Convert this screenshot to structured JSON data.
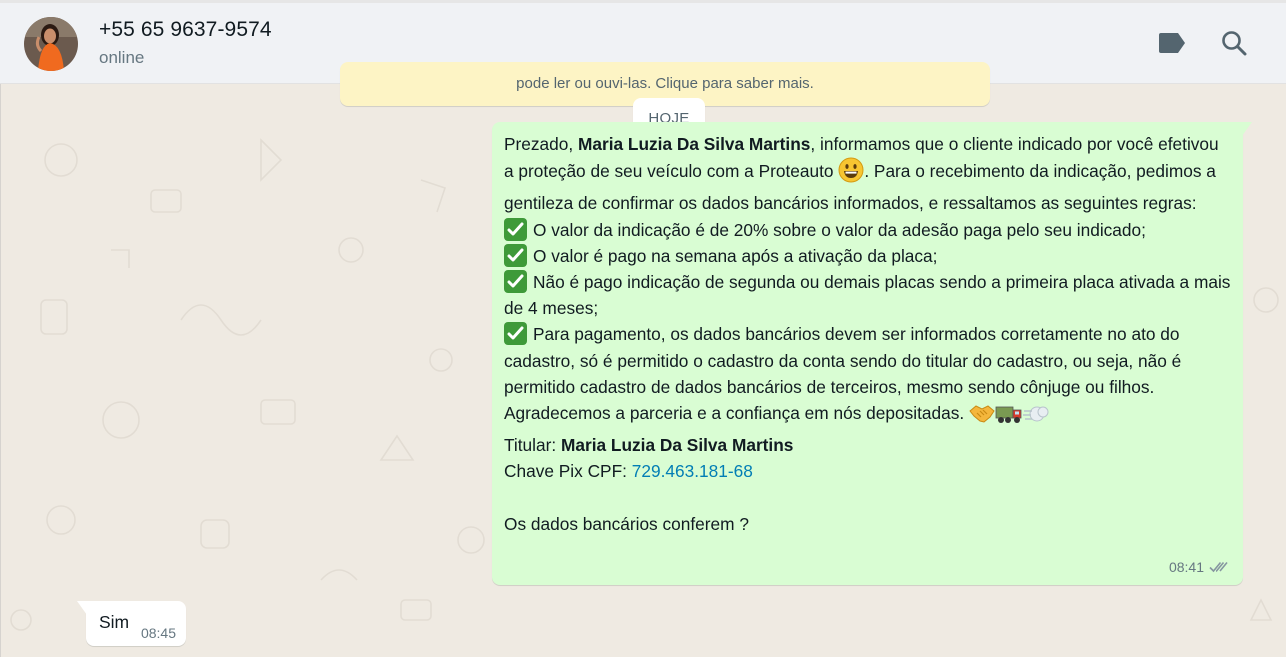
{
  "header": {
    "contact_name": "+55 65 9637-9574",
    "status": "online",
    "icons": [
      "label-icon",
      "search-icon"
    ]
  },
  "notice": {
    "text": "pode ler ou ouvi-las. Clique para saber mais."
  },
  "date_chip": "HOJE",
  "outgoing_message": {
    "p1_a": "Prezado, ",
    "p1_name": "Maria Luzia Da Silva Martins",
    "p1_b": ", informamos que o cliente indicado por você efetivou a proteção de seu veículo com a Proteauto ",
    "p1_c": ". Para o recebimento da indicação, pedimos a gentileza de confirmar os dados bancários informados, e ressaltamos as seguintes regras:",
    "rule1": "O valor da indicação é de 20% sobre o valor da adesão paga pelo seu indicado;",
    "rule2": "O valor é pago na semana após a ativação da placa;",
    "rule3": "Não é pago indicação de segunda ou demais placas sendo a primeira placa ativada a mais de 4 meses;",
    "rule4": "Para pagamento, os dados bancários devem ser informados corretamente no ato do cadastro, só é permitido o cadastro da conta sendo do titular do cadastro, ou seja, não é permitido cadastro de dados bancários de terceiros, mesmo sendo cônjuge ou filhos.",
    "thanks": "Agradecemos a parceria e a confiança em nós depositadas. ",
    "holder_label": "Titular: ",
    "holder_name": "Maria Luzia Da Silva Martins",
    "pix_label": "Chave Pix CPF: ",
    "pix_value": "729.463.181-68",
    "question": "Os dados bancários conferem ?",
    "time": "08:41",
    "status_icon": "double-check-icon"
  },
  "incoming_message": {
    "text": "Sim",
    "time": "08:45"
  },
  "colors": {
    "outgoing_bubble": "#d9fdd3",
    "incoming_bubble": "#ffffff",
    "header_bg": "#f0f2f5",
    "chat_bg": "#efeae2",
    "link": "#027eb5",
    "notice_bg": "#fdf4c5"
  }
}
